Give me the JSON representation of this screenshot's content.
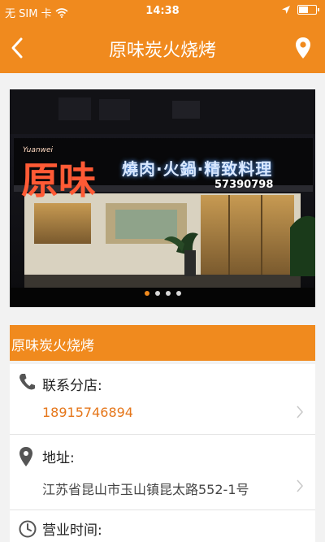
{
  "status_bar": {
    "carrier": "无 SIM 卡",
    "time": "14:38",
    "icons": [
      "wifi-icon",
      "location-arrow-icon",
      "battery-icon"
    ],
    "battery_level": 0.5
  },
  "nav": {
    "title": "原味炭火烧烤",
    "back_icon": "chevron-left-icon",
    "location_icon": "map-pin-icon"
  },
  "banner": {
    "sign_small": "Yuanwei",
    "sign_brand": "原味",
    "sign_text": "燒肉·火鍋·精致料理",
    "sign_phone": "57390798",
    "slide_count": 4,
    "active_slide": 0
  },
  "shop": {
    "name": "原味炭火烧烤",
    "branch_label": "联系分店:",
    "branch_phone": "18915746894",
    "address_label": "地址:",
    "address": "江苏省昆山市玉山镇昆太路552-1号",
    "hours_label": "营业时间:"
  },
  "colors": {
    "accent": "#f08a1e",
    "phone_text": "#e5761a",
    "background": "#f2f2f2"
  }
}
